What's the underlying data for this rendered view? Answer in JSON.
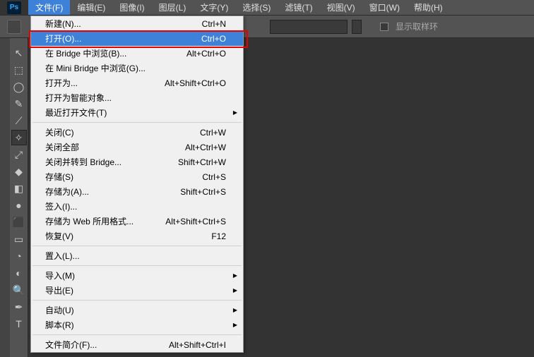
{
  "app": {
    "logo": "Ps"
  },
  "menubar": [
    {
      "label": "文件(F)",
      "active": true
    },
    {
      "label": "编辑(E)"
    },
    {
      "label": "图像(I)"
    },
    {
      "label": "图层(L)"
    },
    {
      "label": "文字(Y)"
    },
    {
      "label": "选择(S)"
    },
    {
      "label": "滤镜(T)"
    },
    {
      "label": "视图(V)"
    },
    {
      "label": "窗口(W)"
    },
    {
      "label": "帮助(H)"
    }
  ],
  "options": {
    "sample_ring_label": "显示取样环"
  },
  "tools": [
    "↖",
    "⬚",
    "◯",
    "✎",
    "⟋",
    "✧",
    "⤢",
    "◆",
    "◧",
    "●",
    "⬛",
    "▭",
    "◔",
    "◐",
    "🔍",
    "✒",
    "T"
  ],
  "dropdown": {
    "groups": [
      [
        {
          "label": "新建(N)...",
          "shortcut": "Ctrl+N"
        },
        {
          "label": "打开(O)...",
          "shortcut": "Ctrl+O",
          "highlighted": true
        },
        {
          "label": "在 Bridge 中浏览(B)...",
          "shortcut": "Alt+Ctrl+O"
        },
        {
          "label": "在 Mini Bridge 中浏览(G)..."
        },
        {
          "label": "打开为...",
          "shortcut": "Alt+Shift+Ctrl+O"
        },
        {
          "label": "打开为智能对象..."
        },
        {
          "label": "最近打开文件(T)",
          "submenu": true
        }
      ],
      [
        {
          "label": "关闭(C)",
          "shortcut": "Ctrl+W"
        },
        {
          "label": "关闭全部",
          "shortcut": "Alt+Ctrl+W"
        },
        {
          "label": "关闭并转到 Bridge...",
          "shortcut": "Shift+Ctrl+W"
        },
        {
          "label": "存储(S)",
          "shortcut": "Ctrl+S"
        },
        {
          "label": "存储为(A)...",
          "shortcut": "Shift+Ctrl+S"
        },
        {
          "label": "签入(I)..."
        },
        {
          "label": "存储为 Web 所用格式...",
          "shortcut": "Alt+Shift+Ctrl+S"
        },
        {
          "label": "恢复(V)",
          "shortcut": "F12"
        }
      ],
      [
        {
          "label": "置入(L)..."
        }
      ],
      [
        {
          "label": "导入(M)",
          "submenu": true
        },
        {
          "label": "导出(E)",
          "submenu": true
        }
      ],
      [
        {
          "label": "自动(U)",
          "submenu": true
        },
        {
          "label": "脚本(R)",
          "submenu": true
        }
      ],
      [
        {
          "label": "文件简介(F)...",
          "shortcut": "Alt+Shift+Ctrl+I"
        }
      ]
    ]
  }
}
